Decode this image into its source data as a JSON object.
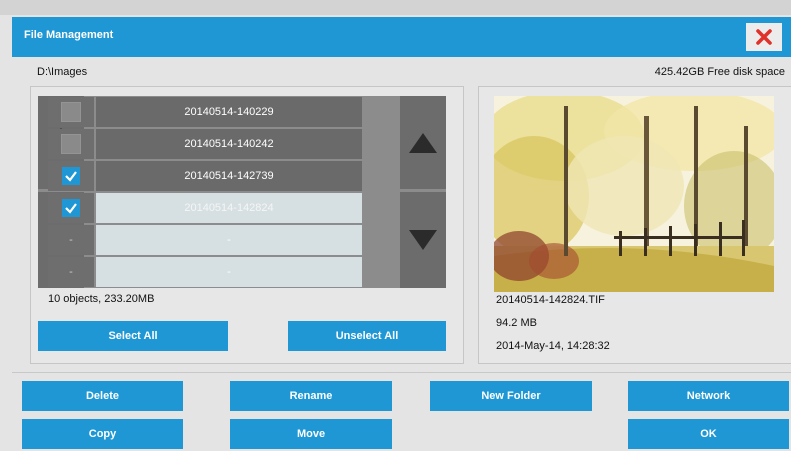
{
  "window": {
    "title": "File Management"
  },
  "header": {
    "path": "D:\\Images",
    "free_space": "425.42GB Free disk space"
  },
  "file_list": {
    "rows": [
      {
        "name": "20140514-140229",
        "checked": false,
        "selected": false
      },
      {
        "name": "20140514-140242",
        "checked": false,
        "selected": false
      },
      {
        "name": "20140514-142739",
        "checked": true,
        "selected": false
      },
      {
        "name": "20140514-142824",
        "checked": true,
        "selected": true
      },
      {
        "name": "-",
        "checked": null,
        "selected": true
      },
      {
        "name": "-",
        "checked": null,
        "selected": true
      }
    ],
    "summary": "10 objects, 233.20MB",
    "select_all_label": "Select All",
    "unselect_all_label": "Unselect All"
  },
  "preview": {
    "filename": "20140514-142824.TIF",
    "size": "94.2 MB",
    "date": "2014-May-14, 14:28:32"
  },
  "actions": {
    "delete_label": "Delete",
    "rename_label": "Rename",
    "new_folder_label": "New Folder",
    "network_label": "Network",
    "copy_label": "Copy",
    "move_label": "Move",
    "ok_label": "OK"
  },
  "colors": {
    "accent": "#1e97d4",
    "close": "#e0312a",
    "list_dark": "#6a6a6a",
    "list_selected": "#d6e0e2"
  },
  "icons": {
    "close": "close-x-icon",
    "page_up": "double-up-arrow-icon",
    "page_down": "double-down-arrow-icon",
    "scroll_up": "up-triangle-icon",
    "scroll_down": "down-triangle-icon",
    "check": "checkmark-icon"
  }
}
